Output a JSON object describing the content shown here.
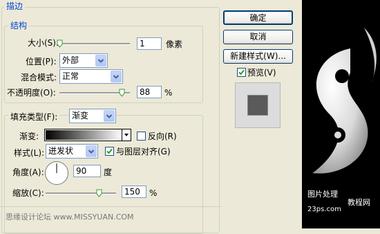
{
  "stroke": {
    "title": "描边",
    "structure": {
      "title": "结构",
      "size_label": "大小(S):",
      "size_value": "1",
      "size_unit": "像素",
      "position_label": "位置(P):",
      "position_value": "外部",
      "blend_label": "混合模式:",
      "blend_value": "正常",
      "opacity_label": "不透明度(O):",
      "opacity_value": "88",
      "opacity_unit": "%"
    },
    "fill": {
      "fill_type_label": "填充类型(F):",
      "fill_type_value": "渐变",
      "gradient_label": "渐变:",
      "reverse_label": "反向(R)",
      "reverse_checked": false,
      "style_label": "样式(L):",
      "style_value": "迸发状",
      "align_label": "与图层对齐(G)",
      "align_checked": true,
      "angle_label": "角度(A):",
      "angle_value": "90",
      "angle_unit": "度",
      "scale_label": "缩放(C):",
      "scale_value": "150",
      "scale_unit": "%"
    }
  },
  "buttons": {
    "ok": "确定",
    "cancel": "取消",
    "new_style": "新建样式(W)...",
    "preview_label": "预览(V)",
    "preview_checked": true
  },
  "footer": {
    "credit": "思缘设计论坛 www.MISSYUAN.COM"
  },
  "watermark": {
    "line1": "图片处理",
    "line2": "教程网",
    "line3": "23ps.com"
  },
  "sliders": {
    "size_fraction": 0.0,
    "opacity_fraction": 0.88,
    "scale_fraction": 0.75
  },
  "colors": {
    "legend_blue": "#0046d5",
    "button_border": "#003c74"
  }
}
